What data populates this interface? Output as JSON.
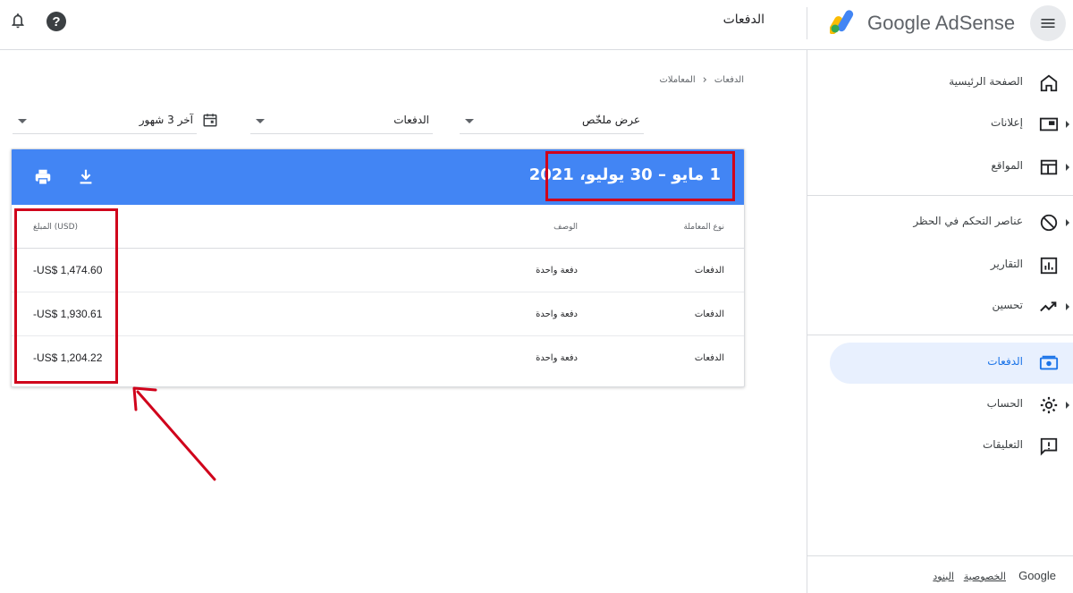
{
  "topbar": {
    "brand": "Google AdSense",
    "page_title": "الدفعات",
    "help_glyph": "?",
    "icons": {
      "menu": "menu-icon",
      "help": "help-icon",
      "bell": "bell-icon",
      "logo": "adsense-logo"
    }
  },
  "breadcrumb": {
    "items": [
      "الدفعات",
      "المعاملات"
    ]
  },
  "filters": {
    "view": "عرض ملخّص",
    "type": "الدفعات",
    "period": "آخر 3 شهور"
  },
  "card": {
    "date_range": "1 مايو – 30 يوليو، 2021",
    "columns": {
      "type": "نوع المعاملة",
      "description": "الوصف",
      "amount": "المبلغ (USD)"
    },
    "rows": [
      {
        "type": "الدفعات",
        "description": "دفعة واحدة",
        "amount": "-US$ 1,474.60"
      },
      {
        "type": "الدفعات",
        "description": "دفعة واحدة",
        "amount": "-US$ 1,930.61"
      },
      {
        "type": "الدفعات",
        "description": "دفعة واحدة",
        "amount": "-US$ 1,204.22"
      }
    ]
  },
  "sidebar": {
    "items": [
      {
        "label": "الصفحة الرئيسية",
        "icon": "home-icon"
      },
      {
        "label": "إعلانات",
        "icon": "ads-icon"
      },
      {
        "label": "المواقع",
        "icon": "sites-icon"
      },
      {
        "label": "عناصر التحكم في الحظر",
        "icon": "block-icon"
      },
      {
        "label": "التقارير",
        "icon": "reports-icon"
      },
      {
        "label": "تحسين",
        "icon": "trending-icon"
      },
      {
        "label": "الدفعات",
        "icon": "payments-icon"
      },
      {
        "label": "الحساب",
        "icon": "gear-icon"
      },
      {
        "label": "التعليقات",
        "icon": "feedback-icon"
      }
    ],
    "active": "الدفعات"
  },
  "footer": {
    "brand": "Google",
    "privacy": "الخصوصية",
    "terms": "البنود"
  },
  "colors": {
    "accent": "#4285f4",
    "highlight": "#d0021b",
    "active_bg": "#e8f0fe",
    "active_text": "#1a73e8"
  }
}
